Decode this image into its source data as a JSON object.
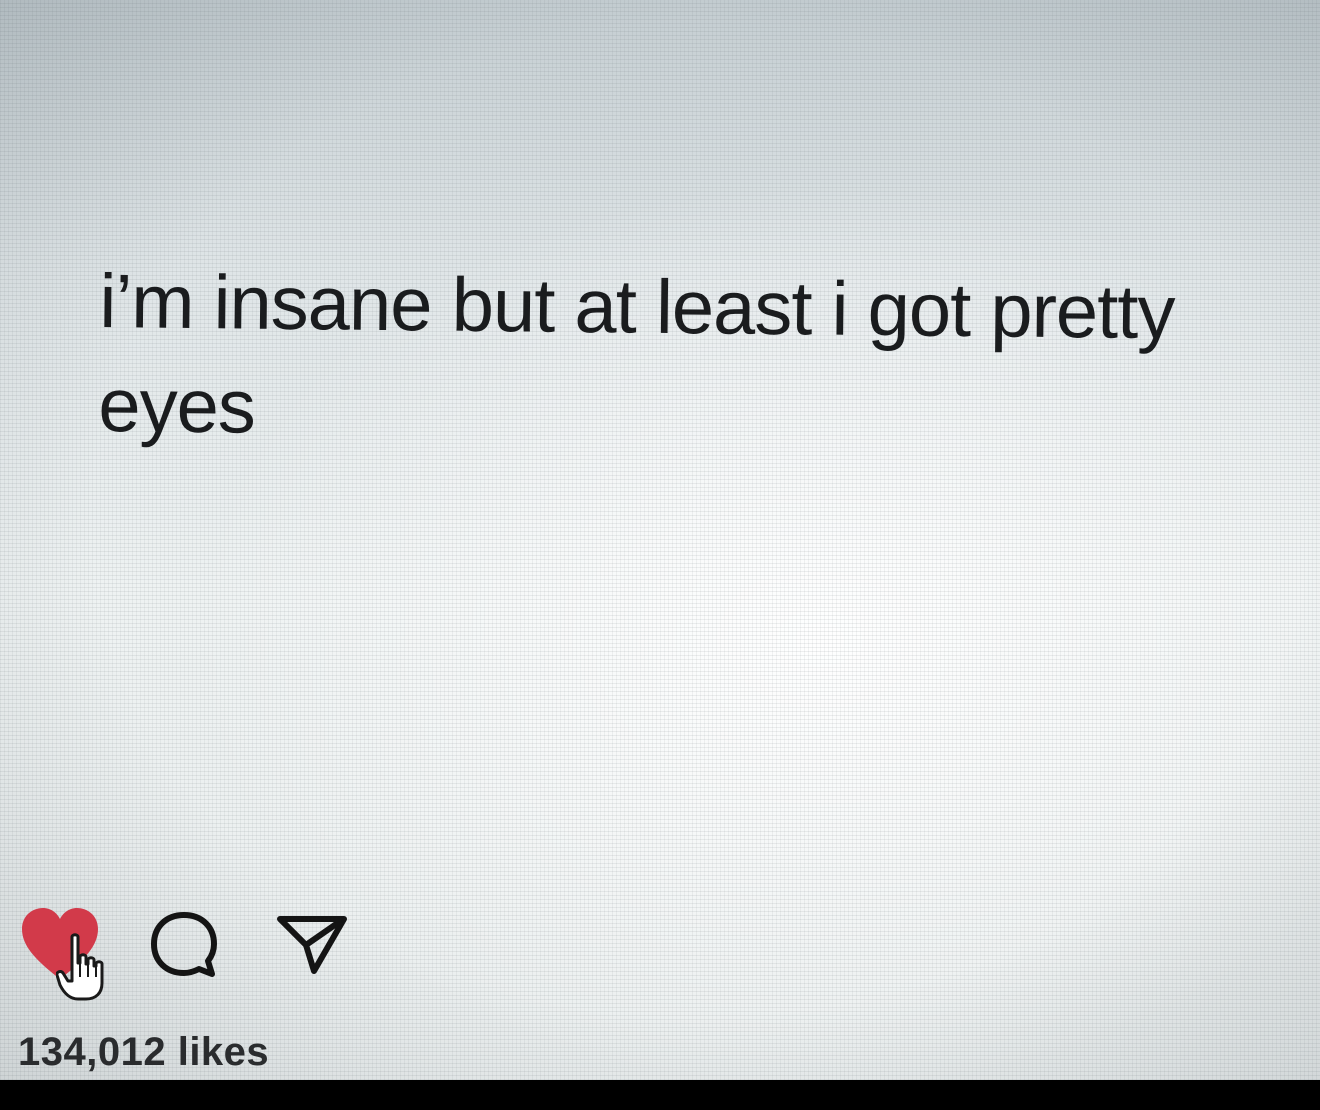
{
  "post": {
    "text": "i’m insane but at least i got pretty eyes"
  },
  "actions": {
    "like_icon": "heart-icon",
    "cursor_icon": "hand-pointer-icon",
    "comment_icon": "comment-bubble-icon",
    "share_icon": "send-paper-plane-icon",
    "liked": true,
    "like_color": "#d23a4a"
  },
  "stats": {
    "likes_label": "134,012 likes"
  }
}
